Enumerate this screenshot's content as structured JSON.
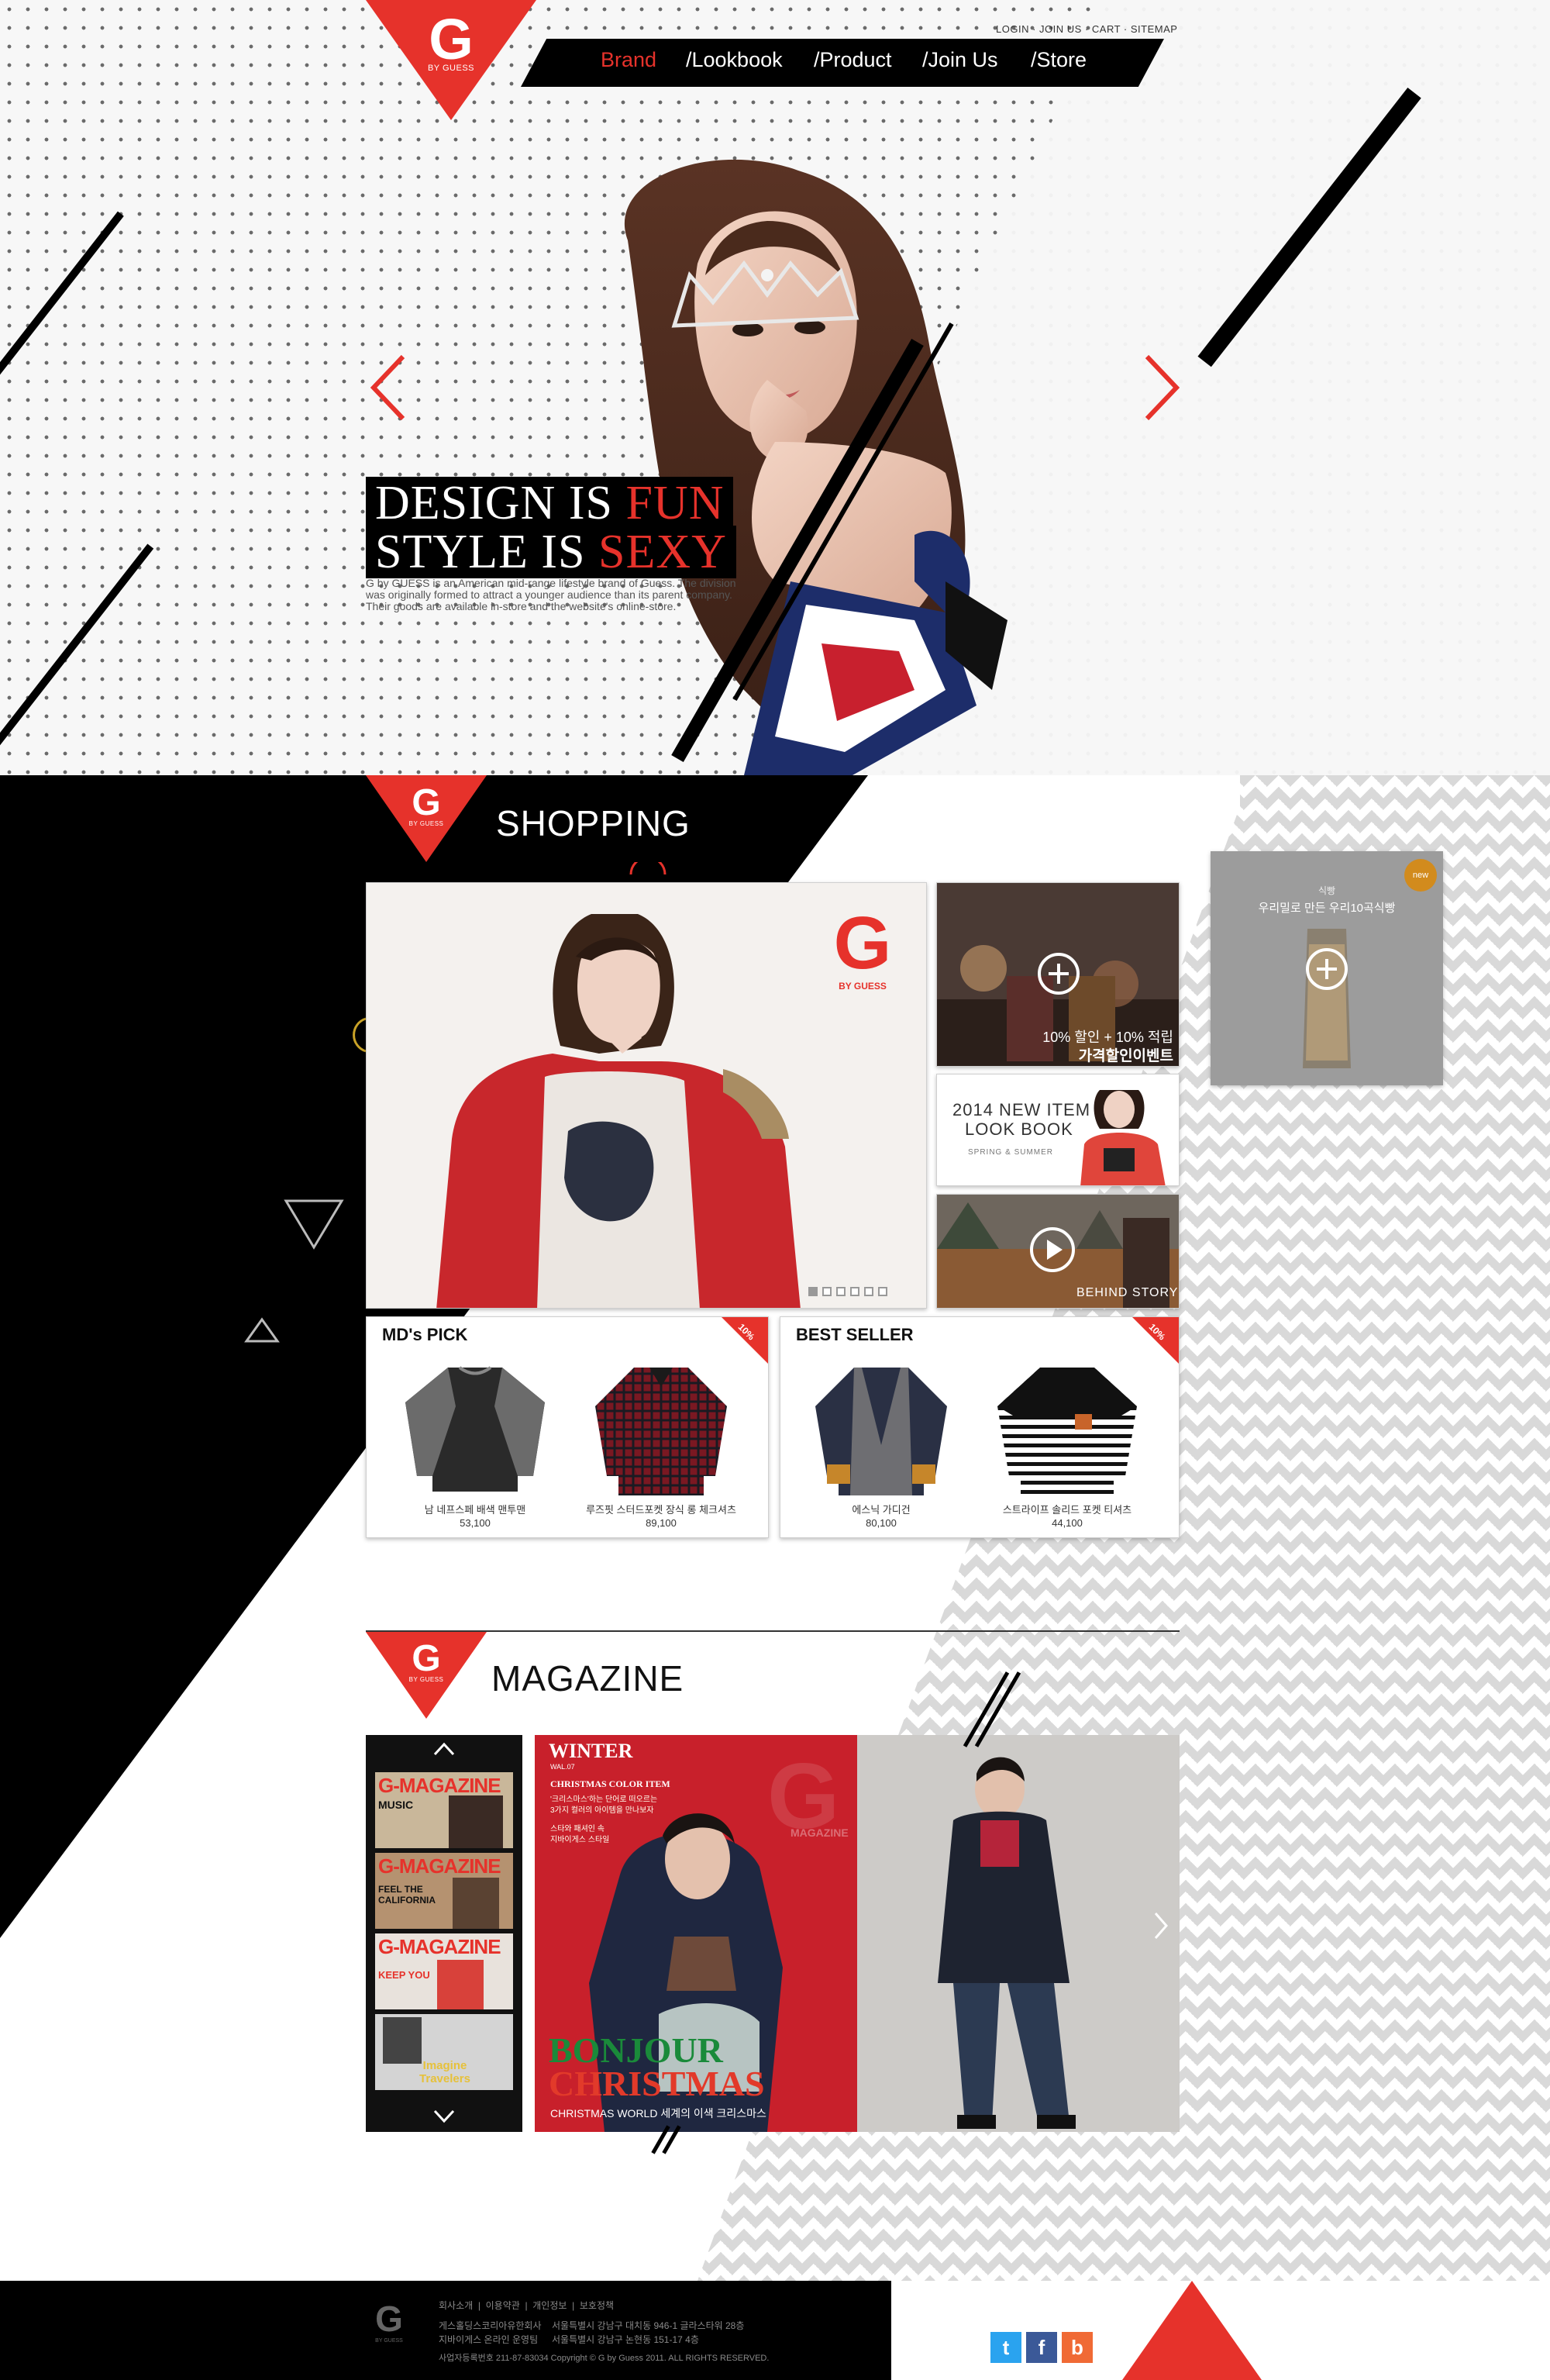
{
  "brand": {
    "letter": "G",
    "sub": "BY GUESS"
  },
  "nav": {
    "top_links": [
      "LOGIN",
      "JOIN US",
      "CART",
      "SITEMAP"
    ],
    "items": [
      "Brand",
      "/Lookbook",
      "/Product",
      "/Join Us",
      "/Store"
    ],
    "active_index": 0
  },
  "hero": {
    "headline_line1_white": "DESIGN IS ",
    "headline_line1_red": "FUN",
    "headline_line2_white": "STYLE IS ",
    "headline_line2_red": "SEXY",
    "description": "G by GUESS is an American mid-range lifestyle brand of Guess. The division was originally formed to attract a younger audience than its parent company. Their goods are available in-store and the website's online-store."
  },
  "shopping": {
    "title": "SHOPPING",
    "banner_logo": "G",
    "banner_logo_sub": "BY GUESS",
    "slider_dots": 6,
    "promo1": {
      "line1": "10% 할인 + 10% 적립",
      "line2": "가격할인이벤트"
    },
    "promo2": {
      "line1": "2014 NEW ITEM",
      "line2": "LOOK BOOK",
      "line3": "SPRING & SUMMER"
    },
    "promo3": {
      "label": "BEHIND STORY"
    },
    "ad": {
      "badge": "new",
      "small": "식빵",
      "text": "우리밀로 만든 우리10곡식빵"
    },
    "mds_pick": {
      "title": "MD's PICK",
      "ribbon": "10%",
      "items": [
        {
          "name": "남 네프스페 배색 맨투맨",
          "price": "53,100"
        },
        {
          "name": "루즈핏 스터드포켓 장식 롱 체크셔츠",
          "price": "89,100"
        }
      ]
    },
    "best_seller": {
      "title": "BEST SELLER",
      "ribbon": "10%",
      "items": [
        {
          "name": "에스닉 가디건",
          "price": "80,100"
        },
        {
          "name": "스트라이프 솔리드 포켓 티셔츠",
          "price": "44,100"
        }
      ]
    }
  },
  "magazine": {
    "title": "MAGAZINE",
    "thumbs": [
      {
        "title": "G-MAGAZINE",
        "tag": "MUSIC"
      },
      {
        "title": "G-MAGAZINE",
        "tag": "FEEL THE CALIFORNIA"
      },
      {
        "title": "G-MAGAZINE",
        "tag": "KEEP YOU"
      },
      {
        "title": "G-MAGAZINE",
        "tag": "Imagine Travelers"
      }
    ],
    "spread": {
      "season": "WINTER",
      "season_sub": "WAL.07",
      "item_title": "CHRISTMAS COLOR ITEM",
      "item_lines": [
        "'크리스마스'하는 단어로 떠오르는",
        "3가지 컬러의 아이템을 만나보자"
      ],
      "note_lines": [
        "스타와 패셔인 속",
        "지바이게스 스타일"
      ],
      "headline1": "BONJOUR",
      "headline2": "CHRISTMAS",
      "caption": "CHRISTMAS WORLD 세계의 이색 크리스마스",
      "watermark": "MAGAZINE"
    }
  },
  "footer": {
    "links": [
      "회사소개",
      "이용약관",
      "개인정보",
      "보호정책"
    ],
    "company_lines": [
      "게스홀딩스코리아유한회사",
      "지바이게스 온라인 운영팀"
    ],
    "address_lines": [
      "서울특별시 강남구 대치동 946-1 글라스타워 28층",
      "서울특별시 강남구 논현동 151-17 4층"
    ],
    "copyright": "사업자등록번호 211-87-83034    Copyright © G by Guess 2011. ALL RIGHTS RESERVED.",
    "social": [
      "t",
      "f",
      "b"
    ]
  },
  "colors": {
    "accent": "#e6322b",
    "dark": "#000000",
    "twitter": "#2aa3ef",
    "facebook": "#3b5998",
    "blogger": "#f06a35"
  }
}
